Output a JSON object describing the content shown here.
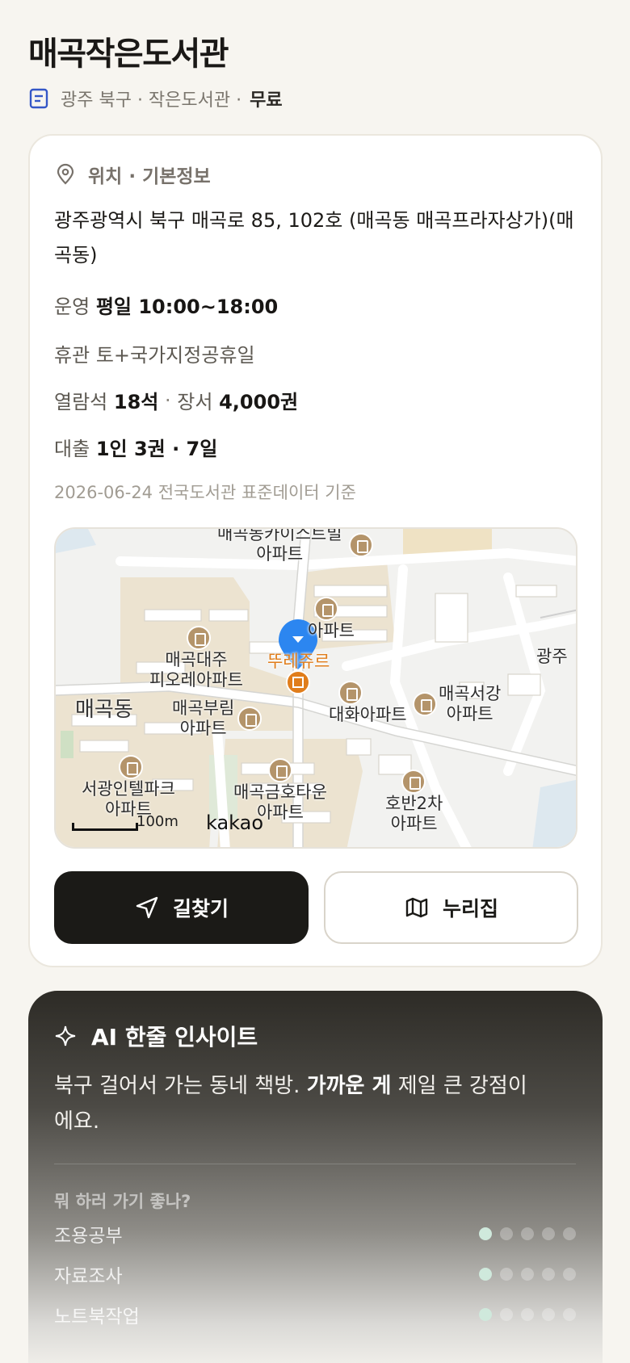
{
  "header": {
    "title": "매곡작은도서관",
    "sub_text": "광주 북구 · 작은도서관 ·",
    "price": "무료"
  },
  "info": {
    "section_title": "위치 · 기본정보",
    "address": "광주광역시 북구 매곡로 85, 102호 (매곡동 매곡프라자상가)(매곡동)",
    "hours_label": "운영",
    "hours_value": "평일 10:00~18:00",
    "closed_label": "휴관",
    "closed_value": "토+국가지정공휴일",
    "seats_label": "열람석",
    "seats_value": "18석",
    "seats_sep": "·",
    "books_label": "장서",
    "books_value": "4,000권",
    "loan_label": "대출",
    "loan_value": "1인 3권 · 7일",
    "data_source": "2026-06-24 전국도서관 표준데이터 기준"
  },
  "map": {
    "labels": {
      "east_apt": "매곡동카이스트빌\n아파트",
      "apt_partial": "아파트",
      "daeju": "매곡대주\n피오레아파트",
      "marker_place": "뚜레쥬르",
      "gwangju": "광주",
      "maegok_dong": "매곡동",
      "burim": "매곡부림\n아파트",
      "daehwa": "대화아파트",
      "seogang": "매곡서강\n아파트",
      "seogwang": "서광인텔파크\n아파트",
      "geumho": "매곡금호타운\n아파트",
      "hoban": "호반2차\n아파트"
    },
    "scale": "100m",
    "attribution": "kakao"
  },
  "actions": {
    "directions": "길찾기",
    "website": "누리집"
  },
  "ai": {
    "title": "AI 한줄 인사이트",
    "text_part1": "북구 걸어서 가는 동네 책방. ",
    "text_bold": "가까운 게",
    "text_part2": " 제일 큰 강점이에요.",
    "question": "뭐 하러 가기 좋나?",
    "ratings": [
      {
        "label": "조용공부",
        "score": 1,
        "max": 5
      },
      {
        "label": "자료조사",
        "score": 1,
        "max": 5
      },
      {
        "label": "노트북작업",
        "score": 1,
        "max": 5
      }
    ],
    "accent_color": "#cfe9dc"
  }
}
